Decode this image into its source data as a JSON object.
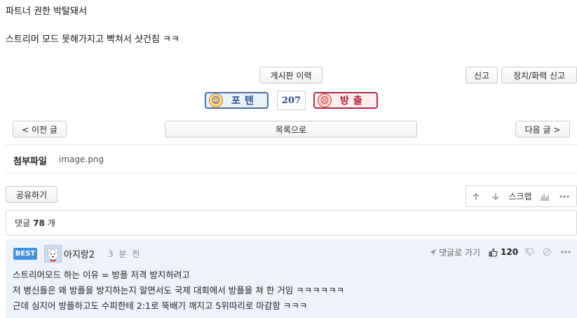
{
  "post": {
    "lines": [
      "파트너 권한 박탈돼서",
      "스트리머 모드 못해가지고 빡쳐서 샷건침 ㅋㅋ"
    ]
  },
  "toolbar": {
    "history_label": "게시판 이력",
    "report_label": "신고",
    "political_report_label": "정치/화력 신고"
  },
  "vote": {
    "up_label": "포텐",
    "count": "207",
    "down_label": "방출"
  },
  "nav": {
    "prev_label": "< 이전 글",
    "list_label": "목록으로",
    "next_label": "다음 글 >"
  },
  "attachment": {
    "label": "첨부파일",
    "filename": "image.png"
  },
  "share": {
    "label": "공유하기"
  },
  "tools": {
    "scrap_label": "스크랩"
  },
  "comments": {
    "prefix": "댓글",
    "count": "78",
    "suffix": "개",
    "best": {
      "badge": "BEST",
      "nickname": "아지랑2",
      "time": "3 분 전",
      "reply_label": "댓글로 가기",
      "like_count": "120",
      "lines": [
        "스트리머모드 하는 이유 = 방플 저격 방지하려고",
        "저 병신들은 왜 방플을 방지하는지 알면서도 국제 대회에서 방플을 쳐 한 거임 ㅋㅋㅋㅋㅋㅋ",
        "근데 심지어 방플하고도 수피한테 2:1로 뚝배기 깨지고 5위따리로 마감함 ㅋㅋㅋ"
      ]
    }
  },
  "icons": {
    "up_arrow": "arrow-up-icon",
    "down_arrow": "arrow-down-icon",
    "stats": "bar-chart-icon",
    "more": "more-dots-icon",
    "reply": "send-arrow-icon",
    "like": "thumbs-up-icon",
    "dislike": "thumbs-down-icon",
    "block": "block-icon"
  },
  "colors": {
    "up_border": "#4a6fa5",
    "down_border": "#b03048",
    "best_badge": "#4a90d9",
    "best_bg": "#eef3fb"
  }
}
